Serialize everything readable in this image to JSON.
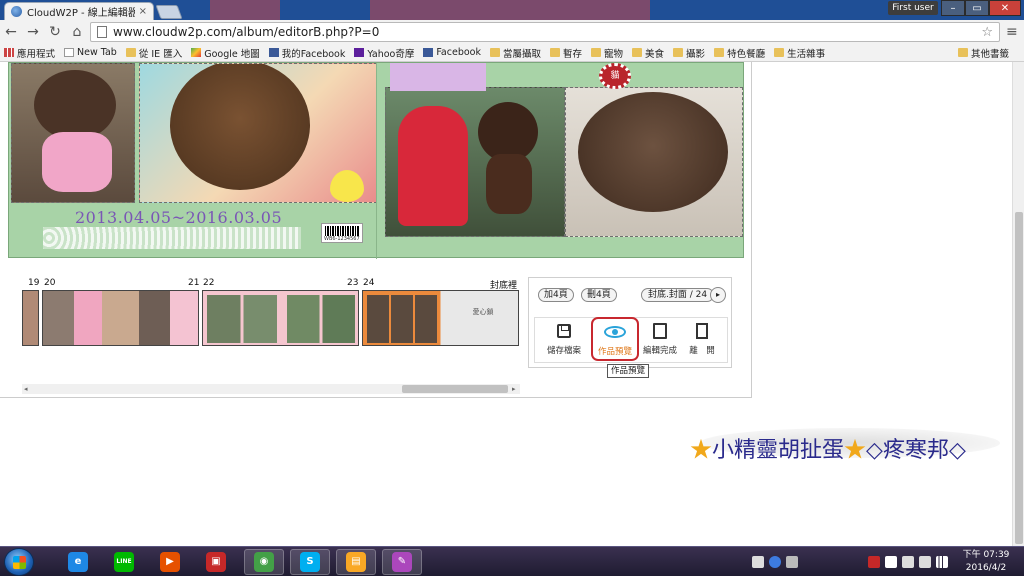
{
  "browser": {
    "tab_title": "CloudW2P - 線上編輯器",
    "tab_close": "×",
    "user_badge": "First user",
    "window_buttons": {
      "minimize": "–",
      "maximize": "▭",
      "close": "✕"
    },
    "nav": {
      "back": "←",
      "forward": "→",
      "reload": "↻",
      "home": "⌂"
    },
    "url": "www.cloudw2p.com/album/editorB.php?P=0",
    "star": "☆",
    "menu": "≡",
    "bookmarks": [
      {
        "label": "應用程式",
        "icon": "apps"
      },
      {
        "label": "New Tab",
        "icon": "doc"
      },
      {
        "label": "從 IE 匯入",
        "icon": "folder"
      },
      {
        "label": "Google 地圖",
        "icon": "gmap"
      },
      {
        "label": "我的Facebook",
        "icon": "fb"
      },
      {
        "label": "Yahoo奇摩",
        "icon": "yh"
      },
      {
        "label": "Facebook",
        "icon": "fb"
      },
      {
        "label": "當屬攝取",
        "icon": "folder"
      },
      {
        "label": "暫存",
        "icon": "folder"
      },
      {
        "label": "寵物",
        "icon": "folder"
      },
      {
        "label": "美食",
        "icon": "folder"
      },
      {
        "label": "攝影",
        "icon": "folder"
      },
      {
        "label": "特色餐廳",
        "icon": "folder"
      },
      {
        "label": "生活雜事",
        "icon": "folder"
      }
    ],
    "other_bookmarks": "其他書籤"
  },
  "editor": {
    "spread": {
      "date_text": "2013.04.05~2016.03.05",
      "barcode_text": "WB6-1234567",
      "badge_text": "貓"
    },
    "page_strip": {
      "page_numbers": [
        "19",
        "20",
        "21",
        "22",
        "23",
        "24"
      ],
      "back_cover_label": "封底裡",
      "back_cover_thumb_text": "愛心鎖"
    },
    "controls": {
      "add_pages": "加4頁",
      "delete_pages": "刪4頁",
      "page_indicator": "封底.封面 / 24",
      "next_arrow": "▸",
      "tools": {
        "save": "儲存檔案",
        "preview": "作品預覽",
        "finish": "編輯完成",
        "exit": "離　開"
      },
      "tooltip": "作品預覽"
    },
    "hscroll": {
      "left_arrow": "◂",
      "right_arrow": "▸"
    }
  },
  "watermark": {
    "text": "小精靈胡扯蛋",
    "text2": "疼寒邦",
    "star": "★",
    "diamond": "◇"
  },
  "taskbar": {
    "apps": [
      {
        "name": "ie",
        "glyph": "e",
        "color": "#1e88e5"
      },
      {
        "name": "line",
        "glyph": "LINE",
        "color": "#00b900"
      },
      {
        "name": "media-player",
        "glyph": "▶",
        "color": "#e65100"
      },
      {
        "name": "store",
        "glyph": "▣",
        "color": "#c62828"
      },
      {
        "name": "chrome",
        "glyph": "◉",
        "color": "#43a047"
      },
      {
        "name": "skype",
        "glyph": "S",
        "color": "#00aff0"
      },
      {
        "name": "explorer",
        "glyph": "▤",
        "color": "#f9a825"
      },
      {
        "name": "paint",
        "glyph": "✎",
        "color": "#ab47bc"
      }
    ],
    "clock": {
      "time": "下午 07:39",
      "date": "2016/4/2"
    }
  },
  "colors": {
    "accent_red": "#c8282f",
    "preview_blue": "#2aa3d9",
    "spread_green": "#a8d3a7",
    "date_purple": "#7a56b5"
  }
}
